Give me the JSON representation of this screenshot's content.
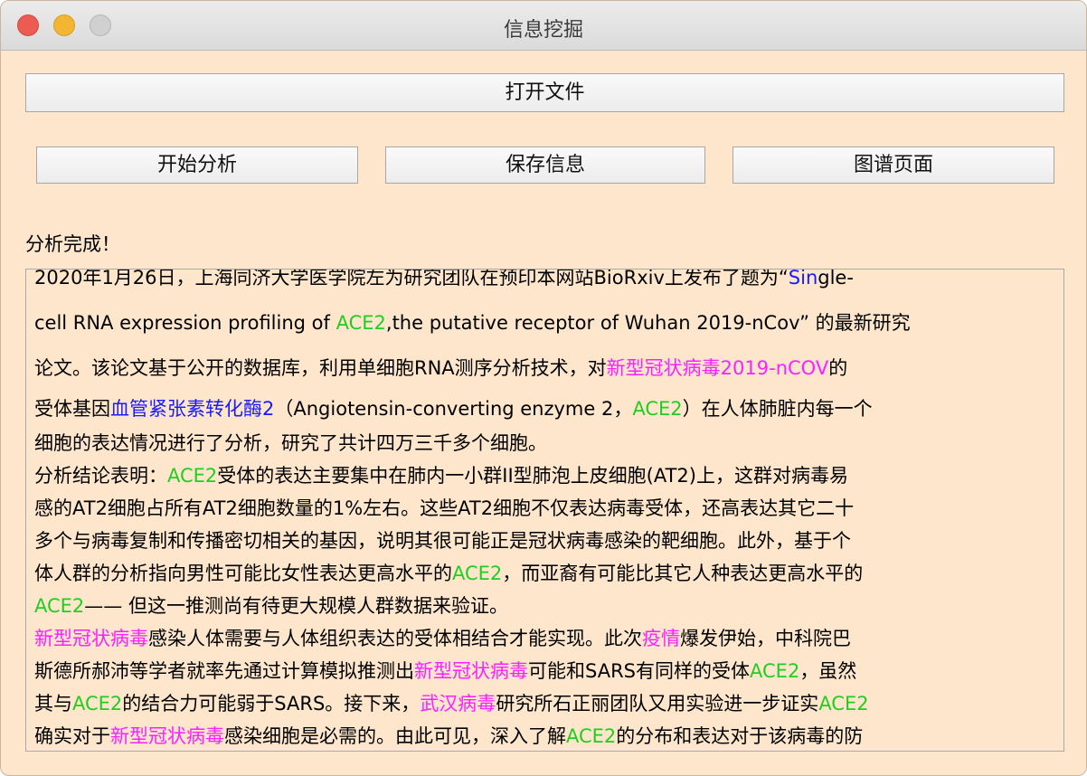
{
  "window": {
    "title": "信息挖掘"
  },
  "toolbar": {
    "open_file": "打开文件",
    "start_analysis": "开始分析",
    "save_info": "保存信息",
    "graph_page": "图谱页面"
  },
  "status": {
    "text": "分析完成！"
  },
  "colors": {
    "window_bg": "#fde6cc",
    "highlight_green": "#1fcf1f",
    "highlight_magenta": "#ff1fff",
    "highlight_blue": "#1a1aff"
  },
  "content": {
    "lines": [
      [
        {
          "t": "2020年1月26日，上海同济大学医学院左为研究团队在预印本网站BioRxiv上发布了题为“"
        },
        {
          "t": "Sin",
          "c": "blue"
        },
        {
          "t": "gle-"
        }
      ],
      [
        {
          "t": "cell RNA expression profiling of "
        },
        {
          "t": "ACE2",
          "c": "green"
        },
        {
          "t": ",the putative receptor of Wuhan 2019-nCov” 的最新研究"
        }
      ],
      [
        {
          "t": "论文。该论文基于公开的数据库，利用单细胞RNA测序分析技术，对"
        },
        {
          "t": "新型冠状病毒2019-nCOV",
          "c": "magenta"
        },
        {
          "t": "的"
        }
      ],
      [
        {
          "t": "受体基因"
        },
        {
          "t": "血管紧张素转化酶2",
          "c": "blue"
        },
        {
          "t": "（Angiotensin-converting enzyme 2，"
        },
        {
          "t": "ACE2",
          "c": "green"
        },
        {
          "t": "）在人体肺脏内每一个"
        }
      ],
      [
        {
          "t": "细胞的表达情况进行了分析，研究了共计四万三千多个细胞。"
        }
      ],
      [
        {
          "t": "分析结论表明："
        },
        {
          "t": "ACE2",
          "c": "green"
        },
        {
          "t": "受体的表达主要集中在肺内一小群II型肺泡上皮细胞(AT2)上，这群对病毒易"
        }
      ],
      [
        {
          "t": "感的AT2细胞占所有AT2细胞数量的1%左右。这些AT2细胞不仅表达病毒受体，还高表达其它二十"
        }
      ],
      [
        {
          "t": "多个与病毒复制和传播密切相关的基因，说明其很可能正是冠状病毒感染的靶细胞。此外，基于个"
        }
      ],
      [
        {
          "t": "体人群的分析指向男性可能比女性表达更高水平的"
        },
        {
          "t": "ACE2",
          "c": "green"
        },
        {
          "t": "，而亚裔有可能比其它人种表达更高水平的"
        }
      ],
      [
        {
          "t": "ACE2",
          "c": "green"
        },
        {
          "t": "—— 但这一推测尚有待更大规模人群数据来验证。"
        }
      ],
      [
        {
          "t": "新型冠状病毒",
          "c": "magenta"
        },
        {
          "t": "感染人体需要与人体组织表达的受体相结合才能实现。此次"
        },
        {
          "t": "疫情",
          "c": "magenta"
        },
        {
          "t": "爆发伊始，中科院巴"
        }
      ],
      [
        {
          "t": "斯德所郝沛等学者就率先通过计算模拟推测出"
        },
        {
          "t": "新型冠状病毒",
          "c": "magenta"
        },
        {
          "t": "可能和SARS有同样的受体"
        },
        {
          "t": "ACE2",
          "c": "green"
        },
        {
          "t": "，虽然"
        }
      ],
      [
        {
          "t": "其与"
        },
        {
          "t": "ACE2",
          "c": "green"
        },
        {
          "t": "的结合力可能弱于SARS。接下来，"
        },
        {
          "t": "武汉病毒",
          "c": "magenta"
        },
        {
          "t": "研究所石正丽团队又用实验进一步证实"
        },
        {
          "t": "ACE2",
          "c": "green"
        }
      ],
      [
        {
          "t": "确实对于"
        },
        {
          "t": "新型冠状病毒",
          "c": "magenta"
        },
        {
          "t": "感染细胞是必需的。由此可见，深入了解"
        },
        {
          "t": "ACE2",
          "c": "green"
        },
        {
          "t": "的分布和表达对于该病毒的防"
        }
      ]
    ]
  }
}
